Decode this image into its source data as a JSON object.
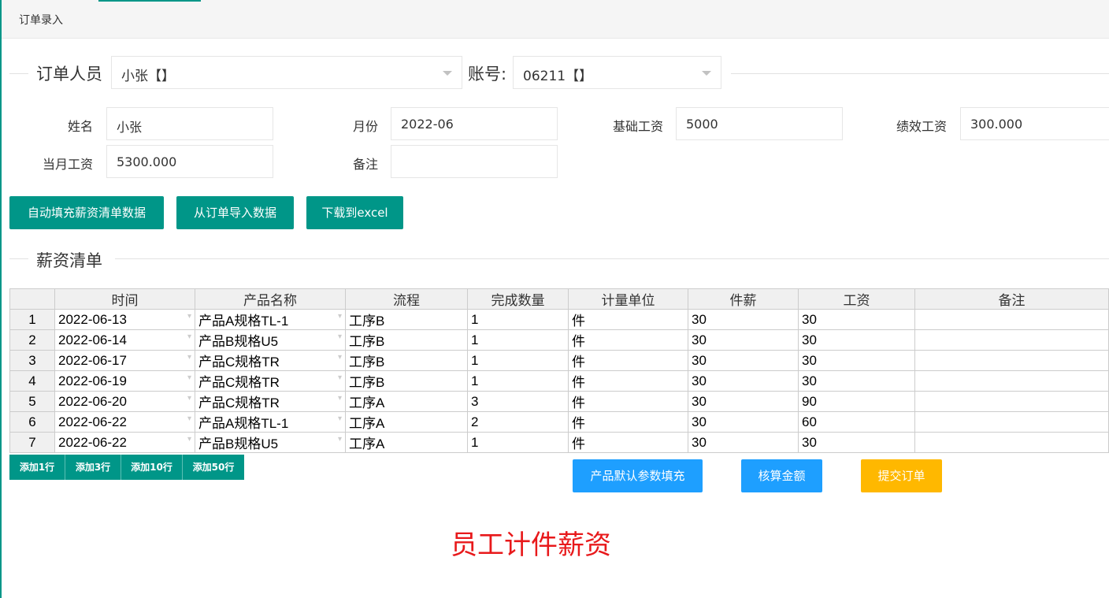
{
  "tab": {
    "title": "订单录入"
  },
  "order_person": {
    "label": "订单人员",
    "value": "小张【】"
  },
  "account": {
    "label": "账号:",
    "value": "06211【】"
  },
  "form": {
    "name": {
      "label": "姓名",
      "value": "小张"
    },
    "month": {
      "label": "月份",
      "value": "2022-06"
    },
    "base_salary": {
      "label": "基础工资",
      "value": "5000"
    },
    "perf_salary": {
      "label": "绩效工资",
      "value": "300.000"
    },
    "monthly_salary": {
      "label": "当月工资",
      "value": "5300.000"
    },
    "remark": {
      "label": "备注",
      "value": ""
    }
  },
  "buttons": {
    "auto_fill": "自动填充薪资清单数据",
    "import_orders": "从订单导入数据",
    "download_excel": "下载到excel",
    "product_default": "产品默认参数填充",
    "calc_amount": "核算金额",
    "submit_order": "提交订单"
  },
  "salary_list": {
    "legend": "薪资清单",
    "columns": [
      "时间",
      "产品名称",
      "流程",
      "完成数量",
      "计量单位",
      "件薪",
      "工资",
      "备注"
    ],
    "rows": [
      [
        "1",
        "2022-06-13",
        "产品A规格TL-1",
        "工序B",
        "1",
        "件",
        "30",
        "30",
        ""
      ],
      [
        "2",
        "2022-06-14",
        "产品B规格U5",
        "工序B",
        "1",
        "件",
        "30",
        "30",
        ""
      ],
      [
        "3",
        "2022-06-17",
        "产品C规格TR",
        "工序B",
        "1",
        "件",
        "30",
        "30",
        ""
      ],
      [
        "4",
        "2022-06-19",
        "产品C规格TR",
        "工序B",
        "1",
        "件",
        "30",
        "30",
        ""
      ],
      [
        "5",
        "2022-06-20",
        "产品C规格TR",
        "工序A",
        "3",
        "件",
        "30",
        "90",
        ""
      ],
      [
        "6",
        "2022-06-22",
        "产品A规格TL-1",
        "工序A",
        "2",
        "件",
        "30",
        "60",
        ""
      ],
      [
        "7",
        "2022-06-22",
        "产品B规格U5",
        "工序A",
        "1",
        "件",
        "30",
        "30",
        ""
      ]
    ]
  },
  "add_rows": [
    "添加1行",
    "添加3行",
    "添加10行",
    "添加50行"
  ],
  "page_caption": "员工计件薪资",
  "colors": {
    "accent": "#009688",
    "blue": "#1e9fff",
    "yellow": "#ffb800",
    "caption": "#e8191b"
  }
}
